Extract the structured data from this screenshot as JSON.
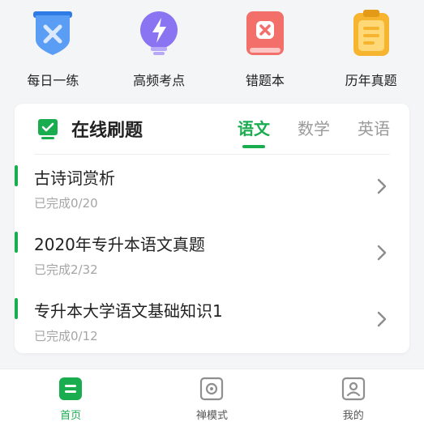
{
  "features": [
    {
      "label": "每日一练",
      "icon": "daily-shield-icon",
      "color": "#4a8ff0"
    },
    {
      "label": "高频考点",
      "icon": "lightning-bulb-icon",
      "color": "#8a6ff0"
    },
    {
      "label": "错题本",
      "icon": "wrong-book-icon",
      "color": "#f06b66"
    },
    {
      "label": "历年真题",
      "icon": "clipboard-icon",
      "color": "#f5b12e"
    }
  ],
  "card": {
    "title": "在线刷题",
    "tabs": [
      {
        "label": "语文",
        "active": true
      },
      {
        "label": "数学",
        "active": false
      },
      {
        "label": "英语",
        "active": false
      }
    ],
    "items": [
      {
        "title": "古诗词赏析",
        "progress": "已完成0/20"
      },
      {
        "title": "2020年专升本语文真题",
        "progress": "已完成2/32"
      },
      {
        "title": "专升本大学语文基础知识1",
        "progress": "已完成0/12"
      }
    ]
  },
  "bottom_nav": [
    {
      "label": "首页",
      "active": true
    },
    {
      "label": "禅模式",
      "active": false
    },
    {
      "label": "我的",
      "active": false
    }
  ],
  "colors": {
    "accent": "#1aad50"
  }
}
